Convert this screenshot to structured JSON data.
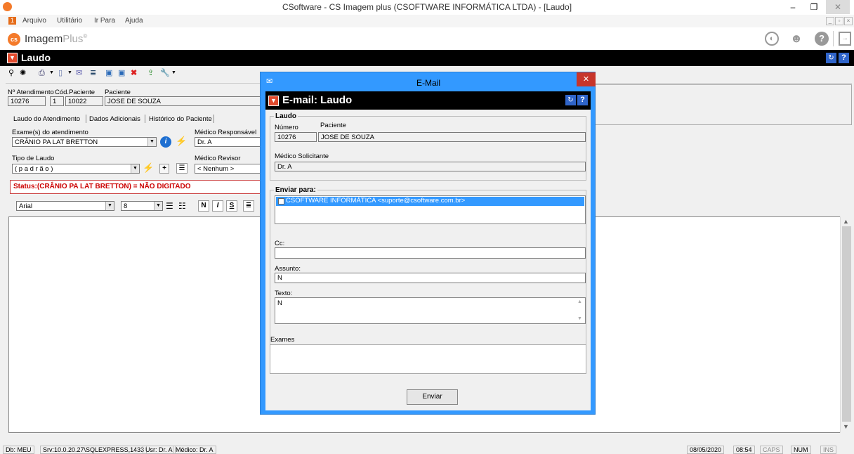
{
  "window": {
    "title": "CSoftware - CS Imagem plus (CSOFTWARE INFORMÁTICA LTDA) - [Laudo]",
    "minimize": "–",
    "restore": "❐",
    "close": "✕"
  },
  "menu": {
    "badge": "1",
    "items": [
      "Arquivo",
      "Utilitário",
      "Ir Para",
      "Ajuda"
    ],
    "mdi": [
      "_",
      "▫",
      "×"
    ]
  },
  "brand": {
    "logo_text": "cs",
    "name_a": "Imagem",
    "name_b": "Plus",
    "reg": "®"
  },
  "header_icons": {
    "globe": "🌐",
    "support": "👤",
    "help": "?",
    "exit": "⇥"
  },
  "laudo_bar": {
    "title": "Laudo",
    "help_a": "↻",
    "help_b": "?"
  },
  "form": {
    "atendimento_label": "Nº Atendimento",
    "atendimento": "10276",
    "cod_label": "Cód.Paciente",
    "cod_prefix": "1",
    "cod": "10022",
    "paciente_label": "Paciente",
    "paciente": "JOSE DE SOUZA",
    "tabs": [
      "Laudo do Atendimento",
      "Dados Adicionais",
      "Histórico do Paciente"
    ],
    "exames_label": "Exame(s) do atendimento",
    "exame": "CRÂNIO PA LAT BRETTON",
    "medico_resp_label": "Médico Responsável",
    "medico_resp": "Dr. A",
    "tipo_label": "Tipo de Laudo",
    "tipo": "( p a d r ã o )",
    "medico_rev_label": "Médico Revisor",
    "medico_rev": "< Nenhum >",
    "status": "Status:(CRÂNIO PA LAT BRETTON) = NÃO DIGITADO",
    "font": "Arial",
    "size": "8",
    "fmt": [
      "N",
      "I",
      "S"
    ],
    "plus": "+"
  },
  "statusbar": {
    "db": "Db: MEU",
    "srv": "Srv:10.0.20.27\\SQLEXPRESS,1433",
    "usr": "Usr: Dr. A",
    "medico": "Médico: Dr. A",
    "date": "08/05/2020",
    "time": "08:54",
    "caps": "CAPS",
    "num": "NUM",
    "ins": "INS"
  },
  "dialog": {
    "title": "E-Mail",
    "close": "✕",
    "header": "E-mail: Laudo",
    "help_a": "↻",
    "help_b": "?",
    "laudo_group": "Laudo",
    "numero_label": "Número",
    "numero": "10276",
    "paciente_label": "Paciente",
    "paciente": "JOSE DE SOUZA",
    "medico_label": "Médico Solicitante",
    "medico": "Dr. A",
    "enviar_label": "Enviar para:",
    "recipient": "CSOFTWARE INFORMÁTICA <suporte@csoftware.com.br>",
    "cc_label": "Cc:",
    "cc": "",
    "assunto_label": "Assunto:",
    "assunto": "N",
    "texto_label": "Texto:",
    "texto": "N",
    "exames_label": "Exames",
    "send": "Enviar"
  },
  "colors": {
    "accent_blue": "#3399ff",
    "status_red": "#cc0000",
    "dialog_close": "#c7352b",
    "black_bar": "#000000"
  }
}
